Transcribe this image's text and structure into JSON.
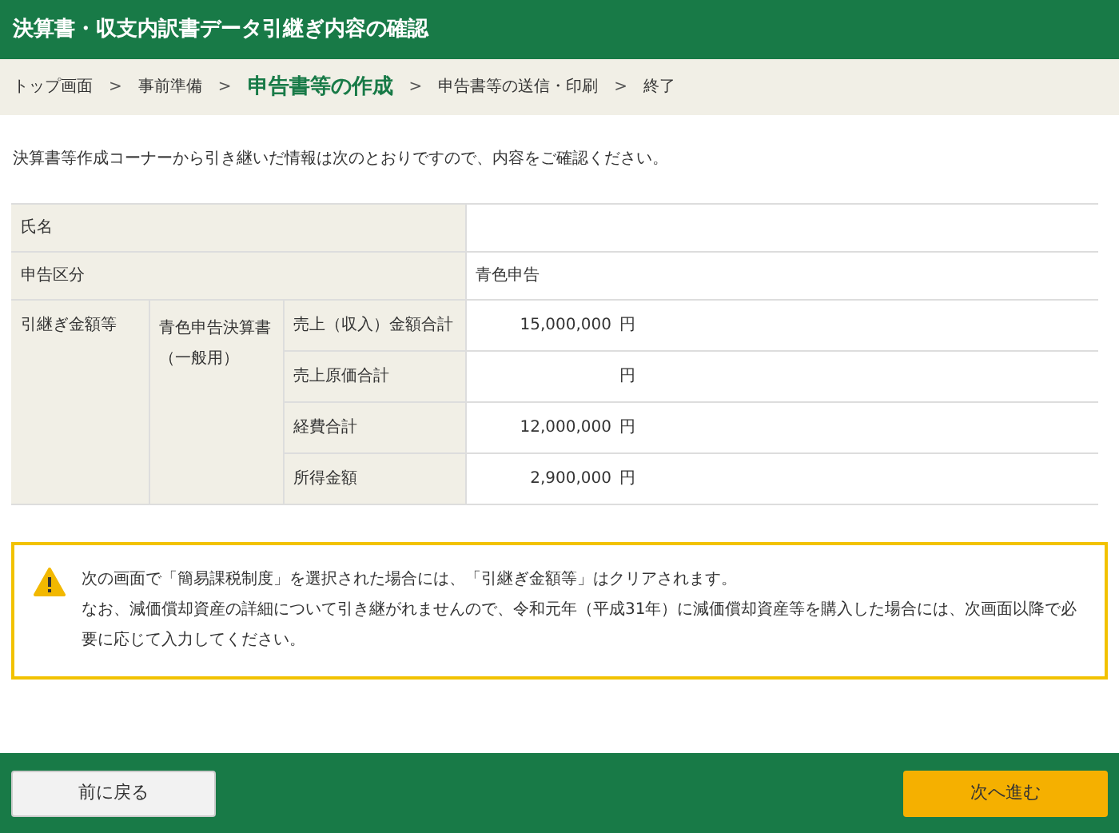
{
  "header": {
    "title": "決算書・収支内訳書データ引継ぎ内容の確認"
  },
  "breadcrumb": [
    {
      "label": "トップ画面",
      "selected": false
    },
    {
      "label": "事前準備",
      "selected": false
    },
    {
      "label": "申告書等の作成",
      "selected": true
    },
    {
      "label": "申告書等の送信・印刷",
      "selected": false
    },
    {
      "label": "終了",
      "selected": false
    }
  ],
  "separator": ">",
  "intro": "決算書等作成コーナーから引き継いだ情報は次のとおりですので、内容をご確認ください。",
  "table": {
    "simple_rows": [
      {
        "label": "氏名"
      },
      {
        "label": "申告区分",
        "value": "青色申告"
      }
    ],
    "carried": {
      "label": "引継ぎ金額等",
      "form": "青色申告決算書（一般用）",
      "items": [
        {
          "label": "売上（収入）金額合計",
          "amount": "15,000,000",
          "unit": "円"
        },
        {
          "label": "売上原価合計",
          "unit": "円"
        },
        {
          "label": "経費合計",
          "amount": "12,000,000",
          "unit": "円"
        },
        {
          "label": "所得金額",
          "amount": "2,900,000",
          "unit": "円"
        }
      ]
    }
  },
  "notice": {
    "lines": [
      "次の画面で「簡易課税制度」を選択された場合には、「引継ぎ金額等」はクリアされます。",
      "なお、減価償却資産の詳細について引き継がれませんので、令和元年（平成31年）に減価償却資産等を購入した場合には、次画面以降で必要に応じて入力してください。"
    ]
  },
  "footer": {
    "back_button": "前に戻る",
    "next_button": "次へ進む"
  }
}
